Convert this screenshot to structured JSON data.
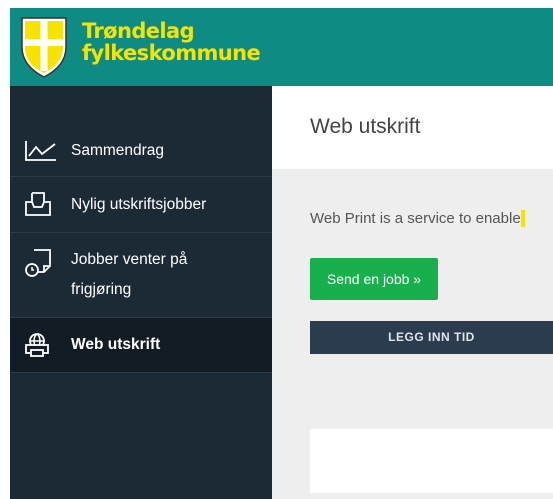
{
  "brand": {
    "line1": "Trøndelag",
    "line2": "fylkeskommune",
    "colors": {
      "header_bg": "#0e8c84",
      "brand_yellow": "#f6e400"
    }
  },
  "sidebar": {
    "items": [
      {
        "label": "Sammendrag",
        "icon": "line-chart-icon",
        "active": false
      },
      {
        "label": "Nylig utskriftsjobber",
        "icon": "printer-tray-icon",
        "active": false
      },
      {
        "label_line1": "Jobber venter på",
        "label_line2": "frigjøring",
        "icon": "document-clock-icon",
        "active": false
      },
      {
        "label": "Web utskrift",
        "icon": "printer-globe-icon",
        "active": true
      }
    ]
  },
  "main": {
    "title": "Web utskrift",
    "intro": "Web Print is a service to enable",
    "send_button": "Send en jobb »",
    "tab_label": "LEGG INN TID",
    "colors": {
      "primary_button": "#18b04c",
      "tab_bg": "#2b3c4e"
    }
  }
}
